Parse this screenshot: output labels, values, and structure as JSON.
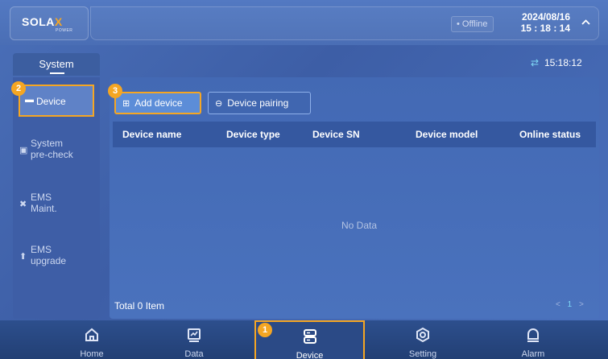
{
  "header": {
    "logo_main": "SOLA",
    "logo_x": "X",
    "logo_sub": "POWER",
    "status": "• Offline",
    "date": "2024/08/16",
    "time": "15 : 18 : 14",
    "collapse_icon": "chevron-up-icon"
  },
  "system_tab": {
    "label": "System"
  },
  "clock": {
    "time": "15:18:12",
    "icon": "refresh-icon"
  },
  "sidebar": {
    "items": [
      {
        "icon": "device-icon",
        "label": "Device",
        "active": true,
        "badge": "2"
      },
      {
        "icon": "precheck-icon",
        "label_line1": "System",
        "label_line2": "pre-check"
      },
      {
        "icon": "tools-icon",
        "label_line1": "EMS",
        "label_line2": "Maint."
      },
      {
        "icon": "upgrade-icon",
        "label_line1": "EMS",
        "label_line2": "upgrade"
      }
    ]
  },
  "toolbar": {
    "add_label": "Add device",
    "add_badge": "3",
    "pair_label": "Device pairing"
  },
  "table": {
    "columns": [
      "Device name",
      "Device type",
      "Device SN",
      "Device model",
      "Online status"
    ],
    "empty_text": "No Data",
    "total_text": "Total 0 Item",
    "pager_prev": "<",
    "pager_page": "1",
    "pager_next": ">"
  },
  "bottom_nav": {
    "items": [
      {
        "icon": "home-icon",
        "label": "Home"
      },
      {
        "icon": "chart-icon",
        "label": "Data"
      },
      {
        "icon": "server-icon",
        "label": "Device",
        "active": true,
        "badge": "1"
      },
      {
        "icon": "settings-icon",
        "label": "Setting"
      },
      {
        "icon": "alarm-icon",
        "label": "Alarm"
      }
    ]
  },
  "colors": {
    "accent_orange": "#f5a623",
    "background": "#4a6fb8",
    "nav_background": "#223f74"
  }
}
